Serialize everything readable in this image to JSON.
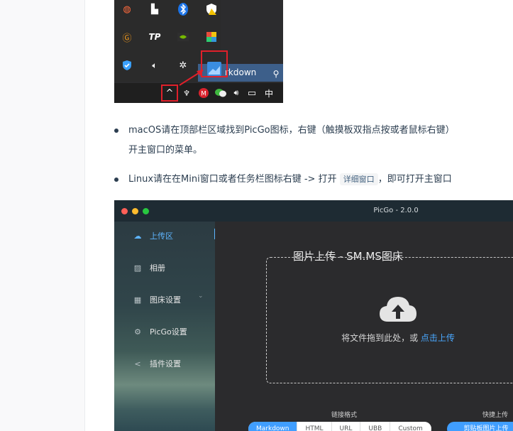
{
  "tray": {
    "taskbar_label": "rkdown",
    "ime_label": "中",
    "icons": [
      "flame-icon",
      "windows-defender-icon",
      "bluetooth-icon",
      "security-warning-icon",
      "g-icon",
      "tp-icon",
      "nvidia-icon",
      "color-palette-icon",
      "shield-check-icon",
      "volume-icon",
      "brightness-icon",
      "picgo-tray-icon"
    ]
  },
  "bullets": [
    {
      "line1": "macOS请在顶部栏区域找到PicGo图标，右键（触摸板双指点按或者鼠标右键）",
      "line2": "开主窗口的菜单。"
    },
    {
      "prefix": "Linux请在在Mini窗口或者任务栏图标右键 -> 打开 ",
      "code": "详细窗口",
      "suffix": "，即可打开主窗口"
    }
  ],
  "picgo": {
    "window_title": "PicGo - 2.0.0",
    "menu": [
      {
        "label": "上传区",
        "icon": "upload-cloud-icon"
      },
      {
        "label": "相册",
        "icon": "image-icon"
      },
      {
        "label": "图床设置",
        "icon": "grid-icon"
      },
      {
        "label": "PicGo设置",
        "icon": "gear-icon"
      },
      {
        "label": "插件设置",
        "icon": "share-icon"
      }
    ],
    "heading": "图片上传 - SM.MS图床",
    "drop_text": "将文件拖到此处，或",
    "drop_link": "点击上传",
    "link_format_label": "链接格式",
    "quick_upload_label": "快捷上传",
    "formats": [
      "Markdown",
      "HTML",
      "URL",
      "UBB",
      "Custom"
    ],
    "selected_format": "Markdown",
    "clipboard_button": "剪贴板图片上传"
  },
  "colors": {
    "accent": "#409eff",
    "red_highlight": "#e0202a"
  }
}
